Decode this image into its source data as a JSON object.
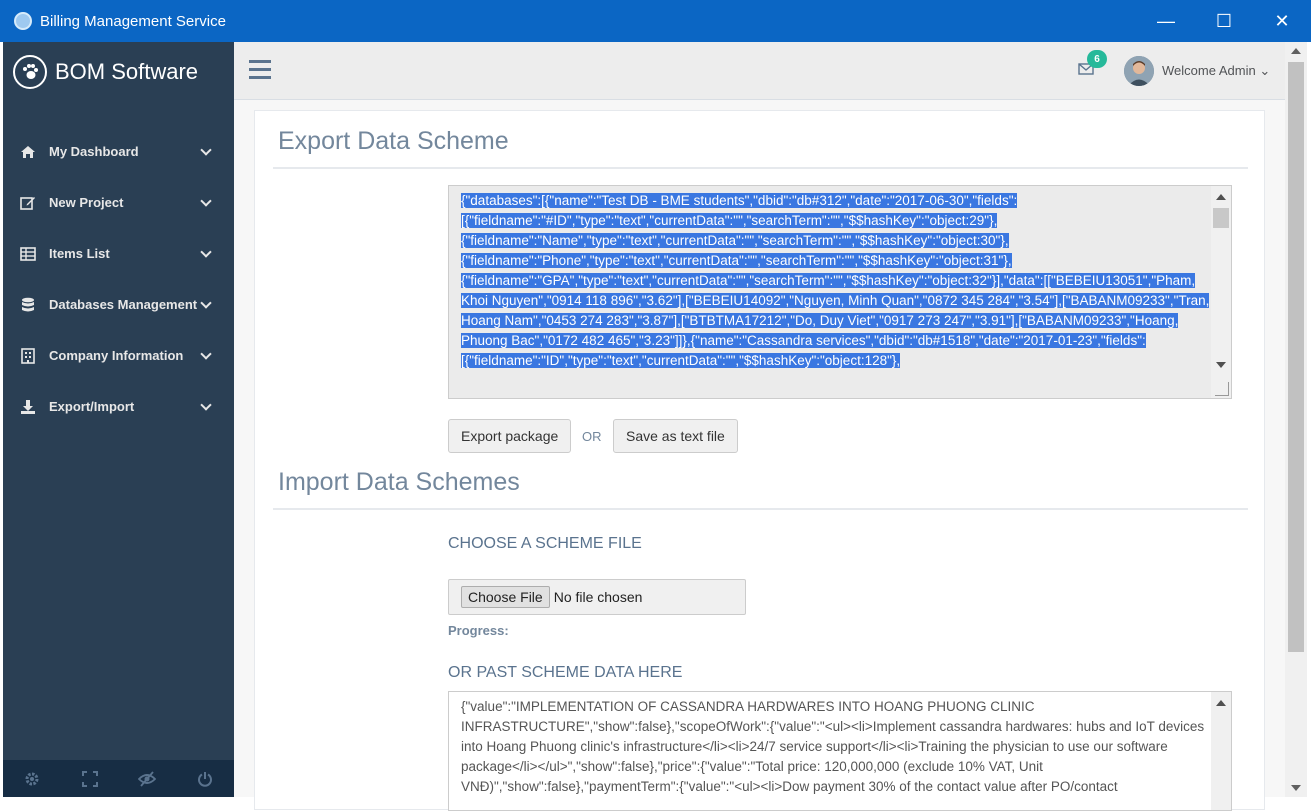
{
  "window": {
    "title": "Billing Management Service",
    "minimize": "—",
    "maximize": "☐",
    "close": "✕"
  },
  "sidebar": {
    "brand": "BOM Software",
    "items": [
      {
        "label": "My Dashboard",
        "icon": "home-icon"
      },
      {
        "label": "New Project",
        "icon": "edit-icon"
      },
      {
        "label": "Items List",
        "icon": "table-icon"
      },
      {
        "label": "Databases Management",
        "icon": "database-icon"
      },
      {
        "label": "Company Information",
        "icon": "building-icon"
      },
      {
        "label": "Export/Import",
        "icon": "download-icon"
      }
    ],
    "footer_icons": [
      "settings-icon",
      "fullscreen-icon",
      "eye-slash-icon",
      "power-icon"
    ]
  },
  "topnav": {
    "mail_count": "6",
    "welcome": "Welcome Admin"
  },
  "export": {
    "title": "Export Data Scheme",
    "data_text": "{\"databases\":[{\"name\":\"Test DB - BME students\",\"dbid\":\"db#312\",\"date\":\"2017-06-30\",\"fields\":[{\"fieldname\":\"#ID\",\"type\":\"text\",\"currentData\":\"\",\"searchTerm\":\"\",\"$$hashKey\":\"object:29\"},{\"fieldname\":\"Name\",\"type\":\"text\",\"currentData\":\"\",\"searchTerm\":\"\",\"$$hashKey\":\"object:30\"},{\"fieldname\":\"Phone\",\"type\":\"text\",\"currentData\":\"\",\"searchTerm\":\"\",\"$$hashKey\":\"object:31\"},{\"fieldname\":\"GPA\",\"type\":\"text\",\"currentData\":\"\",\"searchTerm\":\"\",\"$$hashKey\":\"object:32\"}],\"data\":[[\"BEBEIU13051\",\"Pham, Khoi Nguyen\",\"0914 118 896\",\"3.62\"],[\"BEBEIU14092\",\"Nguyen, Minh Quan\",\"0872 345 284\",\"3.54\"],[\"BABANM09233\",\"Tran, Hoang Nam\",\"0453 274 283\",\"3.87\"],[\"BTBTMA17212\",\"Do, Duy Viet\",\"0917 273 247\",\"3.91\"],[\"BABANM09233\",\"Hoang, Phuong Bac\",\"0172 482 465\",\"3.23\"]]},{\"name\":\"Cassandra services\",\"dbid\":\"db#1518\",\"date\":\"2017-01-23\",\"fields\":[{\"fieldname\":\"ID\",\"type\":\"text\",\"currentData\":\"\",\"$$hashKey\":\"object:128\"},",
    "export_button": "Export package",
    "or_label": "OR",
    "save_button": "Save as text file"
  },
  "import": {
    "title": "Import Data Schemes",
    "choose_label": "CHOOSE A SCHEME FILE",
    "file_button": "Choose File",
    "file_status": "No file chosen",
    "progress_label": "Progress:",
    "paste_label": "OR PAST SCHEME DATA HERE",
    "data_text": "{\"value\":\"IMPLEMENTATION OF CASSANDRA HARDWARES INTO HOANG PHUONG CLINIC INFRASTRUCTURE\",\"show\":false},\"scopeOfWork\":{\"value\":\"<ul><li>Implement cassandra hardwares: hubs and IoT devices into Hoang Phuong clinic's infrastructure</li><li>24/7 service support</li><li>Training the physician to use our software package</li></ul>\",\"show\":false},\"price\":{\"value\":\"Total price: 120,000,000 (exclude 10% VAT, Unit VNĐ)\",\"show\":false},\"paymentTerm\":{\"value\":\"<ul><li>Dow payment 30% of the contact value after PO/contact"
  }
}
